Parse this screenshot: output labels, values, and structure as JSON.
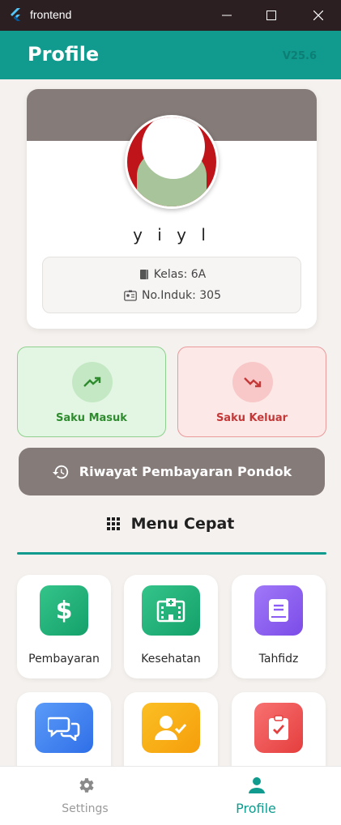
{
  "window": {
    "title": "frontend",
    "icon": "flutter-logo-icon"
  },
  "appbar": {
    "title": "Profile",
    "version": "V25.6"
  },
  "profile": {
    "name": "y   i   y  l",
    "kelas_label": "Kelas: 6A",
    "induk_label": "No.Induk: 305",
    "banner_color": "#857b79"
  },
  "saku": {
    "masuk_label": "Saku Masuk",
    "keluar_label": "Saku Keluar",
    "masuk_color": "#2e8b2e",
    "keluar_color": "#c43838"
  },
  "riwayat": {
    "label": "Riwayat Pembayaran Pondok",
    "icon": "history-icon"
  },
  "menu": {
    "title": "Menu Cepat",
    "icon": "grid-icon",
    "items": [
      {
        "label": "Pembayaran",
        "icon": "dollar-icon",
        "color": "#1fae74"
      },
      {
        "label": "Kesehatan",
        "icon": "hospital-icon",
        "color": "#1fae74"
      },
      {
        "label": "Tahfidz",
        "icon": "book-icon",
        "color": "#8b5cf6"
      },
      {
        "label": "",
        "icon": "chat-icon",
        "color": "#3b82f6"
      },
      {
        "label": "",
        "icon": "user-check-icon",
        "color": "#f59e0b"
      },
      {
        "label": "",
        "icon": "clipboard-check-icon",
        "color": "#ef4444"
      }
    ]
  },
  "bottomnav": {
    "settings_label": "Settings",
    "profile_label": "Profile",
    "active": "Profile",
    "accent": "#109b8e"
  }
}
